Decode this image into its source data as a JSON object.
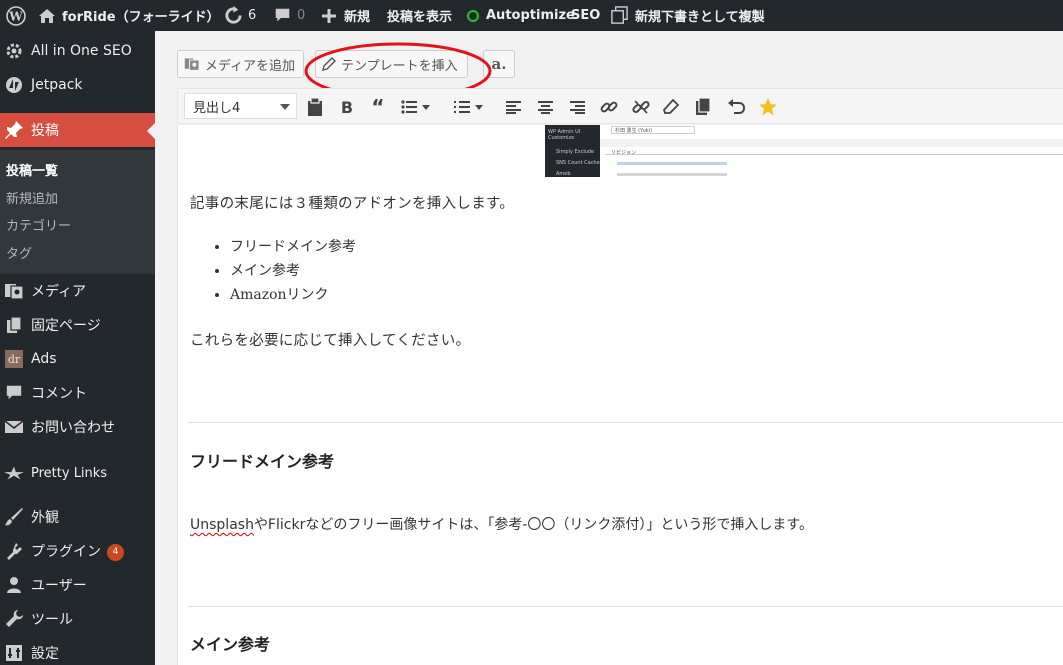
{
  "adminbar": {
    "site_name": "forRide（フォーライド）",
    "updates_count": "6",
    "comments_count": "0",
    "new_label": "新規",
    "view_post": "投稿を表示",
    "autoptimize": "Autoptimize",
    "seo": "SEO",
    "duplicate_draft": "新規下書きとして複製"
  },
  "sidebar": {
    "items": [
      {
        "label": "All in One SEO",
        "icon": "gear-icon"
      },
      {
        "label": "Jetpack",
        "icon": "jetpack-icon"
      },
      {
        "label": "投稿",
        "icon": "pin-icon"
      },
      {
        "label": "メディア",
        "icon": "media-icon"
      },
      {
        "label": "固定ページ",
        "icon": "page-icon"
      },
      {
        "label": "Ads",
        "icon": "ads-icon"
      },
      {
        "label": "コメント",
        "icon": "comment-icon"
      },
      {
        "label": "お問い合わせ",
        "icon": "mail-icon"
      },
      {
        "label": "Pretty Links",
        "icon": "star-link-icon"
      },
      {
        "label": "外観",
        "icon": "brush-icon"
      },
      {
        "label": "プラグイン",
        "icon": "plugin-icon",
        "badge": "4"
      },
      {
        "label": "ユーザー",
        "icon": "user-icon"
      },
      {
        "label": "ツール",
        "icon": "wrench-icon"
      },
      {
        "label": "設定",
        "icon": "settings-icon"
      }
    ],
    "submenu": [
      "投稿一覧",
      "新規追加",
      "カテゴリー",
      "タグ"
    ]
  },
  "editor": {
    "add_media": "メディアを追加",
    "insert_template": "テンプレートを挿入",
    "format_select": "見出し4",
    "accent_color": "#d54e3f",
    "highlight_color": "#e0141e"
  },
  "screenshot_thumb": {
    "menu1": "WP Admin UI Customize",
    "menu2": "Simply Exclude",
    "menu3": "SNS Count Cache",
    "menu4": "Ameb",
    "field": "杉田 勇生 (Yuki)",
    "revision": "リビジョン"
  },
  "content": {
    "intro": "記事の末尾には３種類のアドオンを挿入します。",
    "bullets": [
      "フリードメイン参考",
      "メイン参考",
      "Amazonリンク"
    ],
    "outro": "これらを必要に応じて挿入してください。",
    "heading1": "フリードメイン参考",
    "para2_prefix": "Unsplash",
    "para2_rest": "やFlickrなどのフリー画像サイトは、「参考-〇〇（リンク添付）」という形で挿入します。",
    "heading2": "メイン参考"
  }
}
